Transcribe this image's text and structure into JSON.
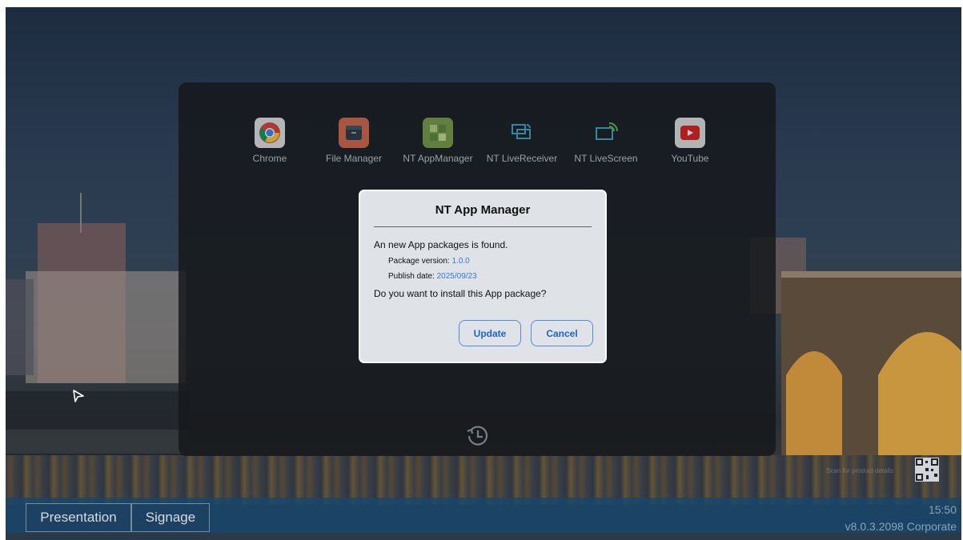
{
  "launcher": {
    "apps": [
      {
        "label": "Chrome",
        "icon": "chrome-icon"
      },
      {
        "label": "File Manager",
        "icon": "file-manager-icon"
      },
      {
        "label": "NT AppManager",
        "icon": "app-manager-icon"
      },
      {
        "label": "NT LiveReceiver",
        "icon": "live-receiver-icon"
      },
      {
        "label": "NT LiveScreen",
        "icon": "live-screen-icon"
      },
      {
        "label": "YouTube",
        "icon": "youtube-icon"
      }
    ]
  },
  "dialog": {
    "title": "NT App Manager",
    "message": "An new App packages is found.",
    "version_label": "Package version: ",
    "version_value": "1.0.0",
    "date_label": "Publish date: ",
    "date_value": "2025/09/23",
    "question": "Do you want to install this App package?",
    "update_label": "Update",
    "cancel_label": "Cancel"
  },
  "taskbar": {
    "presentation_label": "Presentation",
    "signage_label": "Signage",
    "time": "15:50",
    "version": "v8.0.3.2098 Corporate"
  },
  "qr": {
    "label": "Scan for product details"
  },
  "colors": {
    "accent": "#2f7be8",
    "taskbar": "#16466e"
  }
}
